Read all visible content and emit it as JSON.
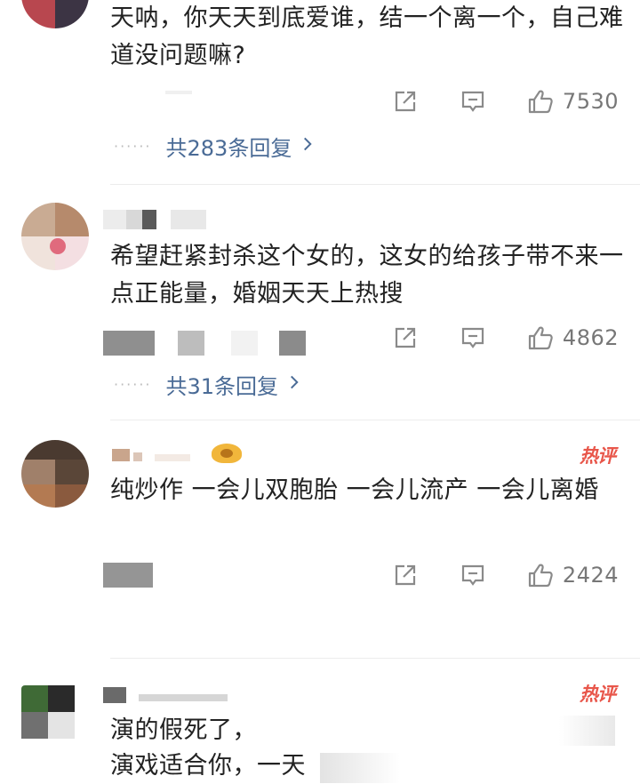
{
  "comments": [
    {
      "text": "天呐，你天天到底爱谁，结一个离一个，自己难道没问题嘛?",
      "likes": "7530",
      "replies": "共283条回复",
      "hot": ""
    },
    {
      "text": "希望赶紧封杀这个女的，这女的给孩子带不来一点正能量，婚姻天天上热搜",
      "likes": "4862",
      "replies": "共31条回复",
      "hot": ""
    },
    {
      "text": "纯炒作 一会儿双胞胎 一会儿流产 一会儿离婚",
      "likes": "2424",
      "replies": "",
      "hot": "热评"
    },
    {
      "text_line1": "演的假死了，",
      "text_line2": "演戏适合你，一天",
      "hot": "热评"
    }
  ],
  "icons": {
    "share": "share-icon",
    "comment": "comment-icon",
    "like": "thumbs-up-icon",
    "chevron": "chevron-right-icon"
  },
  "colors": {
    "reply_link": "#4a6b96",
    "hot_badge": "#e8564a",
    "icon": "#888888"
  }
}
